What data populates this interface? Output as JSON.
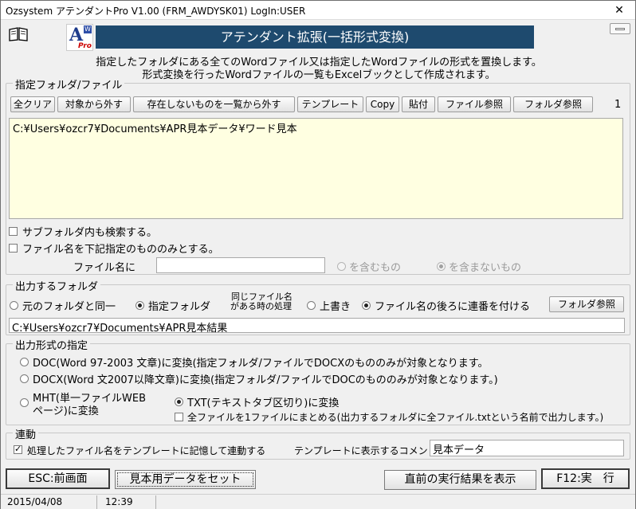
{
  "window": {
    "title": "Ozsystem アテンダントPro V1.00 (FRM_AWDYSK01) LogIn:USER",
    "close_glyph": "✕"
  },
  "logo": {
    "letter": "A",
    "badge": "W",
    "sub": "Pro"
  },
  "banner": "アテンダント拡張(一括形式変換)",
  "description": [
    "指定したフォルダにある全てのWordファイル又は指定したWordファイルの形式を置換します。",
    "形式変換を行ったWordファイルの一覧もExcelブックとして作成されます。"
  ],
  "folder_group": {
    "legend": "指定フォルダ/ファイル",
    "buttons": [
      "全クリア",
      "対象から外す",
      "存在しないものを一覧から外す",
      "テンプレート",
      "Copy",
      "貼付",
      "ファイル参照",
      "フォルダ参照"
    ],
    "count": "1",
    "path": "C:¥Users¥ozcr7¥Documents¥APR見本データ¥ワード見本",
    "subfolder_label": "サブフォルダ内も検索する。",
    "filename_filter_label": "ファイル名を下記指定のもののみとする。",
    "filename_label": "ファイル名に",
    "filename_value": "",
    "include_label": "を含むもの",
    "exclude_label": "を含まないもの"
  },
  "output_group": {
    "legend": "出力するフォルダ",
    "same_folder": "元のフォルダと同一",
    "specified_folder": "指定フォルダ",
    "same_name_line1": "同じファイル名",
    "same_name_line2": "がある時の処理",
    "overwrite": "上書き",
    "append_number": "ファイル名の後ろに連番を付ける",
    "browse": "フォルダ参照",
    "path": "C:¥Users¥ozcr7¥Documents¥APR見本結果"
  },
  "format_group": {
    "legend": "出力形式の指定",
    "doc": "DOC(Word 97-2003 文章)に変換(指定フォルダ/ファイルでDOCXのもののみが対象となります。",
    "docx": "DOCX(Word 文2007以降文章)に変換(指定フォルダ/ファイルでDOCのもののみが対象となります。)",
    "mht_line1": "MHT(単一ファイルWEB",
    "mht_line2": "ページ)に変換",
    "txt": "TXT(テキストタブ区切り)に変換",
    "combine": "全ファイルを1ファイルにまとめる(出力するフォルダに全ファイル.txtという名前で出力します。)"
  },
  "link_group": {
    "legend": "連動",
    "remember": "処理したファイル名をテンプレートに記憶して連動する",
    "comment_label": "テンプレートに表示するコメント",
    "comment_value": "見本データ"
  },
  "footer": {
    "back": "ESC:前画面",
    "set_sample": "見本用データをセット",
    "show_last": "直前の実行結果を表示",
    "execute": "F12:実　行"
  },
  "status": {
    "date": "2015/04/08",
    "time": "12:39"
  }
}
